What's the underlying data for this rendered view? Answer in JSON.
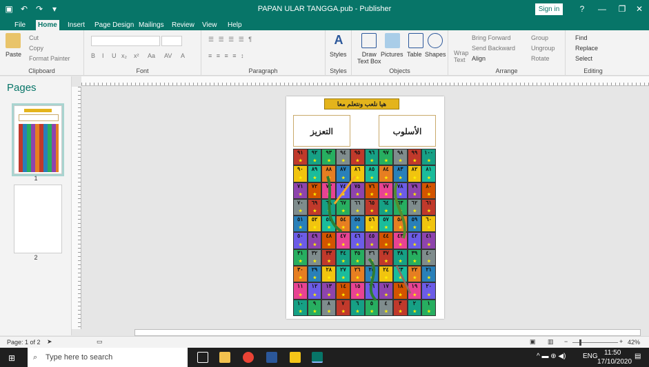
{
  "window": {
    "title": "PAPAN ULAR TANGGA.pub - Publisher",
    "sign_in": "Sign in",
    "help": "?",
    "minimize": "—",
    "restore": "❐",
    "close": "✕"
  },
  "tabs": [
    "File",
    "Home",
    "Insert",
    "Page Design",
    "Mailings",
    "Review",
    "View",
    "Help"
  ],
  "ribbon": {
    "clipboard": {
      "paste": "Paste",
      "cut": "Cut",
      "copy": "Copy",
      "format_painter": "Format Painter",
      "label": "Clipboard"
    },
    "font": {
      "bold": "B",
      "italic": "I",
      "underline": "U",
      "sub": "x₂",
      "sup": "x²",
      "case": "Aa",
      "spacing": "AV",
      "color": "A",
      "label": "Font"
    },
    "paragraph": {
      "label": "Paragraph"
    },
    "styles": {
      "styles": "Styles",
      "label": "Styles"
    },
    "objects": {
      "draw_text_box": "Draw\nText Box",
      "pictures": "Pictures",
      "table": "Table",
      "shapes": "Shapes",
      "label": "Objects"
    },
    "arrange": {
      "wrap_text": "Wrap\nText",
      "bring_forward": "Bring Forward",
      "send_backward": "Send Backward",
      "align": "Align",
      "group": "Group",
      "ungroup": "Ungroup",
      "rotate": "Rotate",
      "label": "Arrange"
    },
    "editing": {
      "find": "Find",
      "replace": "Replace",
      "select": "Select",
      "label": "Editing"
    }
  },
  "pages_pane": {
    "title": "Pages",
    "page1": "1",
    "page2": "2"
  },
  "document": {
    "banner": "هيا نلعب ونتعلم معا",
    "left_box": "التعزيز",
    "right_box": "الأسلوب",
    "rows": [
      [
        "٩١",
        "٩٢",
        "٩٣",
        "٩٤",
        "٩٥",
        "٩٦",
        "٩٧",
        "٩٨",
        "٩٩",
        "١٠٠"
      ],
      [
        "٩٠",
        "٨٩",
        "٨٨",
        "٨٧",
        "٨٦",
        "٨٥",
        "٨٤",
        "٨٣",
        "٨٢",
        "٨١"
      ],
      [
        "٧١",
        "٧٢",
        "٧٣",
        "٧٤",
        "٧٥",
        "٧٦",
        "٧٧",
        "٧٨",
        "٧٩",
        "٨٠"
      ],
      [
        "٧٠",
        "٦٩",
        "٦٨",
        "٦٧",
        "٦٦",
        "٦٥",
        "٦٤",
        "٦٣",
        "٦٢",
        "٦١"
      ],
      [
        "٥١",
        "٥٢",
        "٥٣",
        "٥٤",
        "٥٥",
        "٥٦",
        "٥٧",
        "٥٨",
        "٥٩",
        "٦٠"
      ],
      [
        "٥٠",
        "٤٩",
        "٤٨",
        "٤٧",
        "٤٦",
        "٤٥",
        "٤٤",
        "٤٣",
        "٤٢",
        "٤١"
      ],
      [
        "٣١",
        "٣٢",
        "٣٣",
        "٣٤",
        "٣٥",
        "٣٦",
        "٣٧",
        "٣٨",
        "٣٩",
        "٤٠"
      ],
      [
        "٣٠",
        "٢٩",
        "٢٨",
        "٢٧",
        "٢٦",
        "٢٥",
        "٢٤",
        "٢٣",
        "٢٢",
        "٢١"
      ],
      [
        "١١",
        "١٢",
        "١٣",
        "١٤",
        "١٥",
        "١٦",
        "١٧",
        "١٨",
        "١٩",
        "٢٠"
      ],
      [
        "١٠",
        "٩",
        "٨",
        "٧",
        "٦",
        "٥",
        "٤",
        "٣",
        "٢",
        "١"
      ]
    ],
    "colors": [
      "#c0392b",
      "#e67e22",
      "#8e44ad",
      "#16a085",
      "#2980b9",
      "#d35400",
      "#27ae60",
      "#f1c40f",
      "#e84393",
      "#7f8c8d",
      "#1abc9c",
      "#6c5ce7"
    ]
  },
  "statusbar": {
    "page_info": "Page: 1 of 2",
    "zoom": "42%",
    "zoom_minus": "−",
    "zoom_plus": "+"
  },
  "taskbar": {
    "search_placeholder": "Type here to search",
    "lang": "ENG",
    "time": "11:50",
    "date": "17/10/2020"
  }
}
